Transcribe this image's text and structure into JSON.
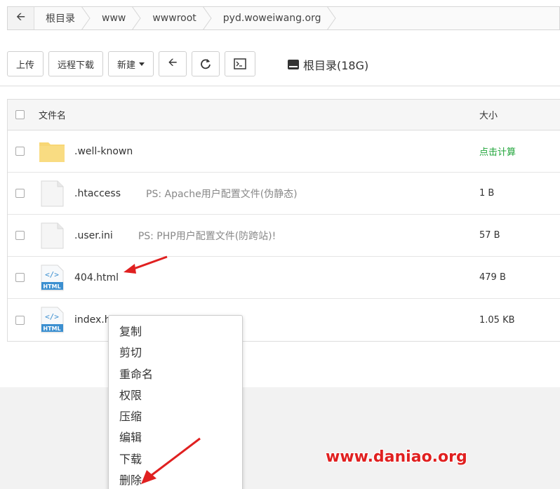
{
  "breadcrumb": {
    "items": [
      "根目录",
      "www",
      "wwwroot",
      "pyd.woweiwang.org"
    ]
  },
  "toolbar": {
    "upload_label": "上传",
    "remote_download_label": "远程下载",
    "new_label": "新建",
    "disk_label": "根目录(18G)"
  },
  "table": {
    "header": {
      "name": "文件名",
      "size": "大小"
    },
    "rows": [
      {
        "name": ".well-known",
        "note": "",
        "size": "点击计算",
        "type": "folder"
      },
      {
        "name": ".htaccess",
        "note": "PS: Apache用户配置文件(伪静态)",
        "size": "1 B",
        "type": "file"
      },
      {
        "name": ".user.ini",
        "note": "PS: PHP用户配置文件(防跨站)!",
        "size": "57 B",
        "type": "file"
      },
      {
        "name": "404.html",
        "note": "",
        "size": "479 B",
        "type": "html"
      },
      {
        "name": "index.html",
        "note": "",
        "size": "1.05 KB",
        "type": "html"
      }
    ]
  },
  "context_menu": {
    "items": [
      "复制",
      "剪切",
      "重命名",
      "权限",
      "压缩",
      "编辑",
      "下载",
      "删除"
    ]
  },
  "watermark": "www.daniao.org",
  "colors": {
    "accent_green": "#20a53a",
    "annotation_red": "#e02020",
    "folder_yellow": "#f8d775"
  }
}
